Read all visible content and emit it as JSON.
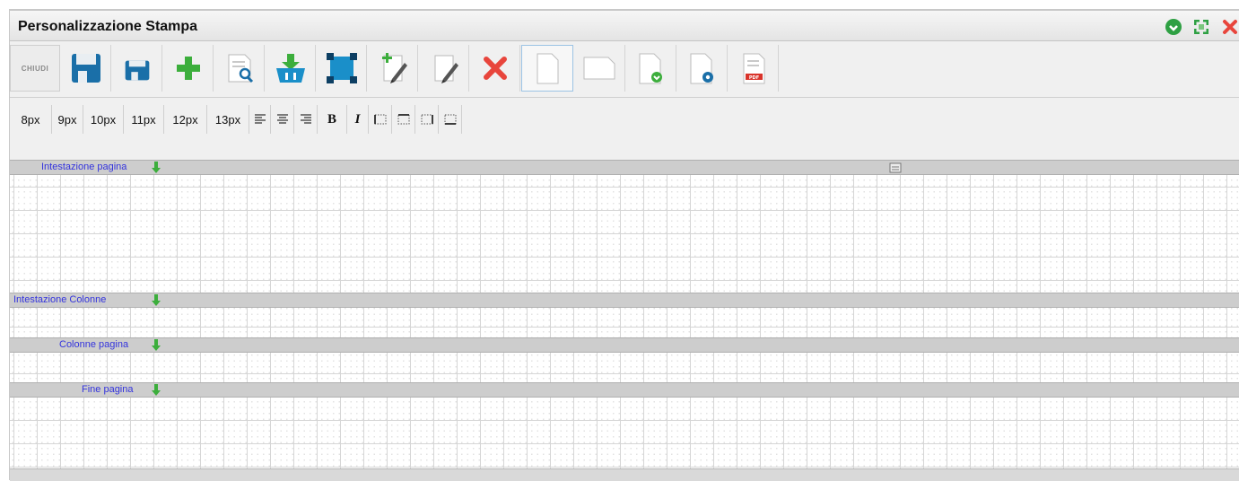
{
  "window": {
    "title": "Personalizzazione Stampa",
    "controls": [
      "add-circle-icon",
      "expand-icon",
      "close-icon"
    ]
  },
  "toolbar": {
    "close_label": "CHIUDI",
    "buttons": [
      "save-icon",
      "save-small-icon",
      "add-icon",
      "preview-icon",
      "basket-download-icon",
      "select-all-icon",
      "new-field-icon",
      "edit-icon",
      "delete-icon",
      "page-portrait-icon",
      "page-landscape-icon",
      "page-add-icon",
      "page-options-icon",
      "pdf-icon"
    ]
  },
  "format_bar": {
    "sizes": [
      "8px",
      "9px",
      "10px",
      "11px",
      "12px",
      "13px"
    ],
    "bold": "B",
    "italic": "I"
  },
  "bands": {
    "header": "Intestazione pagina",
    "columns_header": "Intestazione Colonne",
    "columns": "Colonne pagina",
    "footer": "Fine pagina"
  },
  "colors": {
    "accent_green": "#2ea043",
    "band_label": "#3333dd",
    "delete_red": "#e8453c"
  }
}
